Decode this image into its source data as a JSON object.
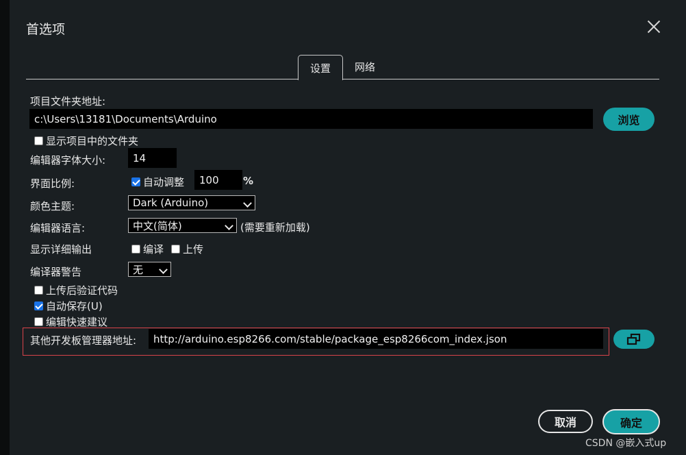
{
  "dialog": {
    "title": "首选项"
  },
  "tabs": [
    {
      "label": "设置"
    },
    {
      "label": "网络"
    }
  ],
  "sketchbook": {
    "label": "项目文件夹地址:",
    "value": "c:\\Users\\13181\\Documents\\Arduino",
    "browse_label": "浏览"
  },
  "show_files": {
    "label": "显示项目中的文件夹",
    "checked": false
  },
  "font_size": {
    "label": "编辑器字体大小:",
    "value": "14"
  },
  "scale": {
    "label": "界面比例:",
    "auto_label": "自动调整",
    "auto_checked": true,
    "value": "100",
    "unit": "%"
  },
  "theme": {
    "label": "颜色主题:",
    "value": "Dark (Arduino)"
  },
  "language": {
    "label": "编辑器语言:",
    "value": "中文(简体)",
    "note": "(需要重新加载)"
  },
  "verbose": {
    "label": "显示详细输出",
    "compile_label": "编译",
    "upload_label": "上传",
    "compile_checked": false,
    "upload_checked": false
  },
  "warnings": {
    "label": "编译器警告",
    "value": "无"
  },
  "verify_after_upload": {
    "label": "上传后验证代码",
    "checked": false
  },
  "auto_save": {
    "label": "自动保存(U)",
    "checked": true
  },
  "quick_suggestions": {
    "label": "编辑快速建议",
    "checked": false
  },
  "board_manager": {
    "label": "其他开发板管理器地址:",
    "value": "http://arduino.esp8266.com/stable/package_esp8266com_index.json"
  },
  "footer": {
    "cancel_label": "取消",
    "ok_label": "确定"
  },
  "watermark": "CSDN @嵌入式up",
  "colors": {
    "accent": "#17a1a5",
    "background": "#1a1f22",
    "highlight_border": "#d9434a"
  }
}
